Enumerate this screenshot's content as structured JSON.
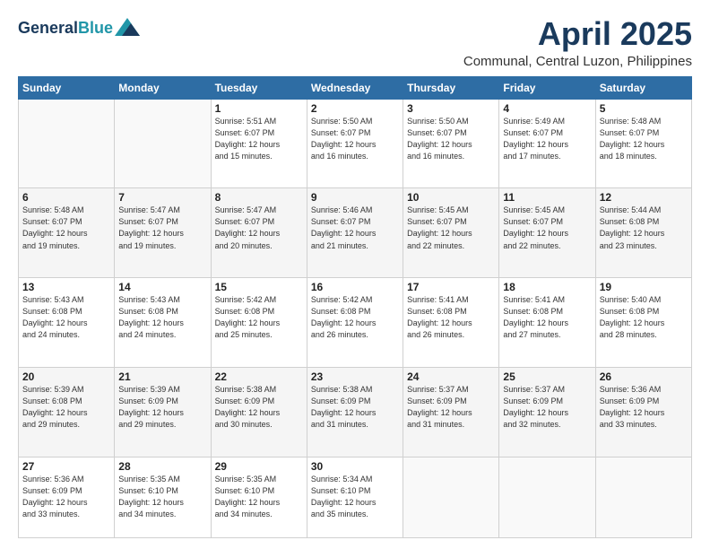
{
  "header": {
    "logo_line1": "General",
    "logo_line2": "Blue",
    "month": "April 2025",
    "location": "Communal, Central Luzon, Philippines"
  },
  "days_of_week": [
    "Sunday",
    "Monday",
    "Tuesday",
    "Wednesday",
    "Thursday",
    "Friday",
    "Saturday"
  ],
  "weeks": [
    [
      {
        "day": "",
        "info": ""
      },
      {
        "day": "",
        "info": ""
      },
      {
        "day": "1",
        "info": "Sunrise: 5:51 AM\nSunset: 6:07 PM\nDaylight: 12 hours\nand 15 minutes."
      },
      {
        "day": "2",
        "info": "Sunrise: 5:50 AM\nSunset: 6:07 PM\nDaylight: 12 hours\nand 16 minutes."
      },
      {
        "day": "3",
        "info": "Sunrise: 5:50 AM\nSunset: 6:07 PM\nDaylight: 12 hours\nand 16 minutes."
      },
      {
        "day": "4",
        "info": "Sunrise: 5:49 AM\nSunset: 6:07 PM\nDaylight: 12 hours\nand 17 minutes."
      },
      {
        "day": "5",
        "info": "Sunrise: 5:48 AM\nSunset: 6:07 PM\nDaylight: 12 hours\nand 18 minutes."
      }
    ],
    [
      {
        "day": "6",
        "info": "Sunrise: 5:48 AM\nSunset: 6:07 PM\nDaylight: 12 hours\nand 19 minutes."
      },
      {
        "day": "7",
        "info": "Sunrise: 5:47 AM\nSunset: 6:07 PM\nDaylight: 12 hours\nand 19 minutes."
      },
      {
        "day": "8",
        "info": "Sunrise: 5:47 AM\nSunset: 6:07 PM\nDaylight: 12 hours\nand 20 minutes."
      },
      {
        "day": "9",
        "info": "Sunrise: 5:46 AM\nSunset: 6:07 PM\nDaylight: 12 hours\nand 21 minutes."
      },
      {
        "day": "10",
        "info": "Sunrise: 5:45 AM\nSunset: 6:07 PM\nDaylight: 12 hours\nand 22 minutes."
      },
      {
        "day": "11",
        "info": "Sunrise: 5:45 AM\nSunset: 6:07 PM\nDaylight: 12 hours\nand 22 minutes."
      },
      {
        "day": "12",
        "info": "Sunrise: 5:44 AM\nSunset: 6:08 PM\nDaylight: 12 hours\nand 23 minutes."
      }
    ],
    [
      {
        "day": "13",
        "info": "Sunrise: 5:43 AM\nSunset: 6:08 PM\nDaylight: 12 hours\nand 24 minutes."
      },
      {
        "day": "14",
        "info": "Sunrise: 5:43 AM\nSunset: 6:08 PM\nDaylight: 12 hours\nand 24 minutes."
      },
      {
        "day": "15",
        "info": "Sunrise: 5:42 AM\nSunset: 6:08 PM\nDaylight: 12 hours\nand 25 minutes."
      },
      {
        "day": "16",
        "info": "Sunrise: 5:42 AM\nSunset: 6:08 PM\nDaylight: 12 hours\nand 26 minutes."
      },
      {
        "day": "17",
        "info": "Sunrise: 5:41 AM\nSunset: 6:08 PM\nDaylight: 12 hours\nand 26 minutes."
      },
      {
        "day": "18",
        "info": "Sunrise: 5:41 AM\nSunset: 6:08 PM\nDaylight: 12 hours\nand 27 minutes."
      },
      {
        "day": "19",
        "info": "Sunrise: 5:40 AM\nSunset: 6:08 PM\nDaylight: 12 hours\nand 28 minutes."
      }
    ],
    [
      {
        "day": "20",
        "info": "Sunrise: 5:39 AM\nSunset: 6:08 PM\nDaylight: 12 hours\nand 29 minutes."
      },
      {
        "day": "21",
        "info": "Sunrise: 5:39 AM\nSunset: 6:09 PM\nDaylight: 12 hours\nand 29 minutes."
      },
      {
        "day": "22",
        "info": "Sunrise: 5:38 AM\nSunset: 6:09 PM\nDaylight: 12 hours\nand 30 minutes."
      },
      {
        "day": "23",
        "info": "Sunrise: 5:38 AM\nSunset: 6:09 PM\nDaylight: 12 hours\nand 31 minutes."
      },
      {
        "day": "24",
        "info": "Sunrise: 5:37 AM\nSunset: 6:09 PM\nDaylight: 12 hours\nand 31 minutes."
      },
      {
        "day": "25",
        "info": "Sunrise: 5:37 AM\nSunset: 6:09 PM\nDaylight: 12 hours\nand 32 minutes."
      },
      {
        "day": "26",
        "info": "Sunrise: 5:36 AM\nSunset: 6:09 PM\nDaylight: 12 hours\nand 33 minutes."
      }
    ],
    [
      {
        "day": "27",
        "info": "Sunrise: 5:36 AM\nSunset: 6:09 PM\nDaylight: 12 hours\nand 33 minutes."
      },
      {
        "day": "28",
        "info": "Sunrise: 5:35 AM\nSunset: 6:10 PM\nDaylight: 12 hours\nand 34 minutes."
      },
      {
        "day": "29",
        "info": "Sunrise: 5:35 AM\nSunset: 6:10 PM\nDaylight: 12 hours\nand 34 minutes."
      },
      {
        "day": "30",
        "info": "Sunrise: 5:34 AM\nSunset: 6:10 PM\nDaylight: 12 hours\nand 35 minutes."
      },
      {
        "day": "",
        "info": ""
      },
      {
        "day": "",
        "info": ""
      },
      {
        "day": "",
        "info": ""
      }
    ]
  ]
}
